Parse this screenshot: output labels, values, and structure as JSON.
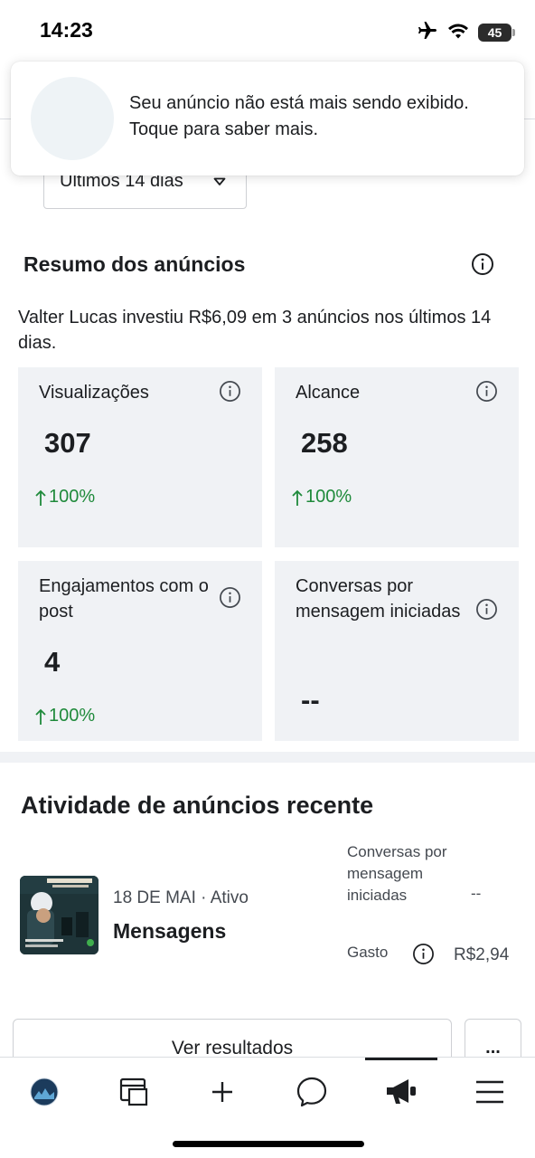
{
  "status_bar": {
    "time": "14:23",
    "battery": "45",
    "icons": [
      "airplane-icon",
      "wifi-icon",
      "battery-icon"
    ]
  },
  "toast": {
    "message": "Seu anúncio não está mais sendo exibido. Toque para saber mais."
  },
  "date_filter": {
    "selected": "Últimos 14 dias"
  },
  "summary": {
    "title": "Resumo dos anúncios",
    "description": "Valter Lucas investiu R$6,09 em 3 anúncios nos últimos 14 dias.",
    "metrics": [
      {
        "label": "Visualizações",
        "value": "307",
        "change": "100%"
      },
      {
        "label": "Alcance",
        "value": "258",
        "change": "100%"
      },
      {
        "label": "Engajamentos com o post",
        "value": "4",
        "change": "100%"
      },
      {
        "label": "Conversas por mensagem iniciadas",
        "value": "--",
        "change": ""
      }
    ]
  },
  "activity": {
    "title": "Atividade de anúncios recente",
    "ad": {
      "date_status": "18 DE MAI · Ativo",
      "name": "Mensagens",
      "metric_label": "Conversas por mensagem iniciadas",
      "metric_value": "--",
      "spend_label": "Gasto",
      "spend_value": "R$2,94"
    }
  },
  "buttons": {
    "results": "Ver resultados",
    "more": "..."
  },
  "nav": {
    "items": [
      "profile-avatar",
      "pages-icon",
      "create-icon",
      "messages-icon",
      "ads-icon",
      "menu-icon"
    ],
    "active": "ads-icon"
  },
  "colors": {
    "positive": "#1f8a3b",
    "card_bg": "#f0f2f5",
    "text": "#1c1e21"
  }
}
